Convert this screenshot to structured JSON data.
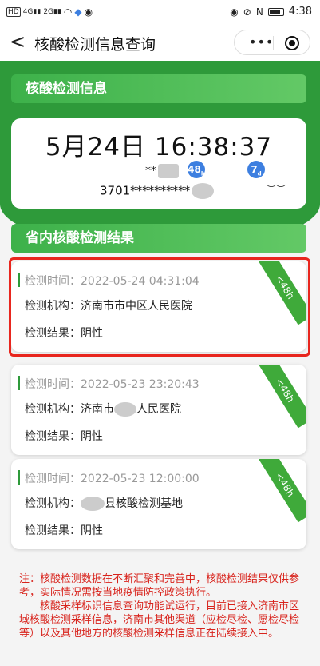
{
  "status_bar": {
    "left": [
      "HD",
      "4G",
      "2G"
    ],
    "time": "4:38"
  },
  "nav": {
    "title": "核酸检测信息查询",
    "back_icon": "back-icon",
    "more_icon": "more-icon",
    "close_icon": "target-icon"
  },
  "info_section": {
    "header": "核酸检测信息",
    "datetime": "5月24日 16:38:37",
    "name": "**",
    "badge_48": "48",
    "badge_48_sub": "h",
    "badge_7": "7",
    "badge_7_sub": "d",
    "id_number": "3701**********",
    "eye_icon": "eye-closed-icon"
  },
  "results_section": {
    "header": "省内核酸检测结果",
    "labels": {
      "time": "检测时间：",
      "org": "检测机构：",
      "result": "检测结果："
    },
    "records": [
      {
        "time": "2022-05-24 04:31:04",
        "org": "济南市市中区人民医院",
        "result": "阴性",
        "ribbon": "<48h"
      },
      {
        "time": "2022-05-23 23:20:43",
        "org_prefix": "济南市",
        "org_suffix": "人民医院",
        "result": "阴性",
        "ribbon": "<48h"
      },
      {
        "time": "2022-05-23 12:00:00",
        "org_suffix": "县核酸检测基地",
        "result": "阴性",
        "ribbon": "<48h"
      }
    ]
  },
  "notes": {
    "line1": "注：核酸检测数据在不断汇聚和完善中，核酸检测结果仅供参考，实际情况需按当地疫情防控政策执行。",
    "line2": "核酸采样标识信息查询功能试运行，目前已接入济南市区域核酸检测采样信息，济南市其他渠道（应检尽检、愿检尽检等）以及其他地方的核酸检测采样信息正在陆续接入中。"
  },
  "colors": {
    "green": "#2e9a3a",
    "badge_blue": "#3d7fe0",
    "note_red": "#d8231c",
    "highlight_red": "#e8261e"
  }
}
